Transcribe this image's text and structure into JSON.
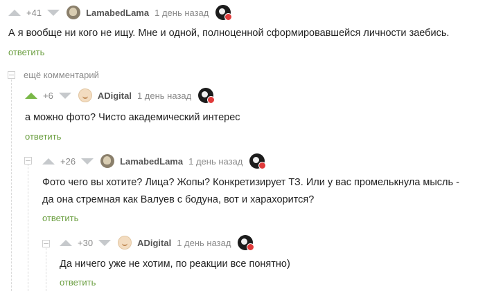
{
  "comments": [
    {
      "rating": "+41",
      "username": "LamabedLama",
      "time": "1 день назад",
      "text": "А я вообще ни кого не ищу. Мне и одной, полноценной сформировавшейся личности заебись.",
      "reply": "ответить"
    },
    {
      "rating": "+6",
      "username": "ADigital",
      "time": "1 день назад",
      "text": "а можно фото? Чисто академический интерес",
      "reply": "ответить"
    },
    {
      "rating": "+26",
      "username": "LamabedLama",
      "time": "1 день назад",
      "text_line1": "Фото чего вы хотите? Лица? Жопы? Конкретизирует ТЗ. Или у вас промелькнула мысль -",
      "text_line2": "да она стремная как Валуев с бодуна, вот и харахорится?",
      "reply": "ответить"
    },
    {
      "rating": "+30",
      "username": "ADigital",
      "time": "1 день назад",
      "text": "Да ничего уже не хотим, по реакции все понятно)",
      "reply": "ответить"
    }
  ],
  "more_comments_label": "ещё комментарий",
  "colors": {
    "upvote_active": "#7ab848",
    "reply_link": "#6a9e3f",
    "vote_inactive": "#c6c9cc"
  },
  "icons": [
    "upvote-arrow-icon",
    "downvote-arrow-icon",
    "user-avatar",
    "author-badge-icon",
    "collapse-thread-icon"
  ]
}
